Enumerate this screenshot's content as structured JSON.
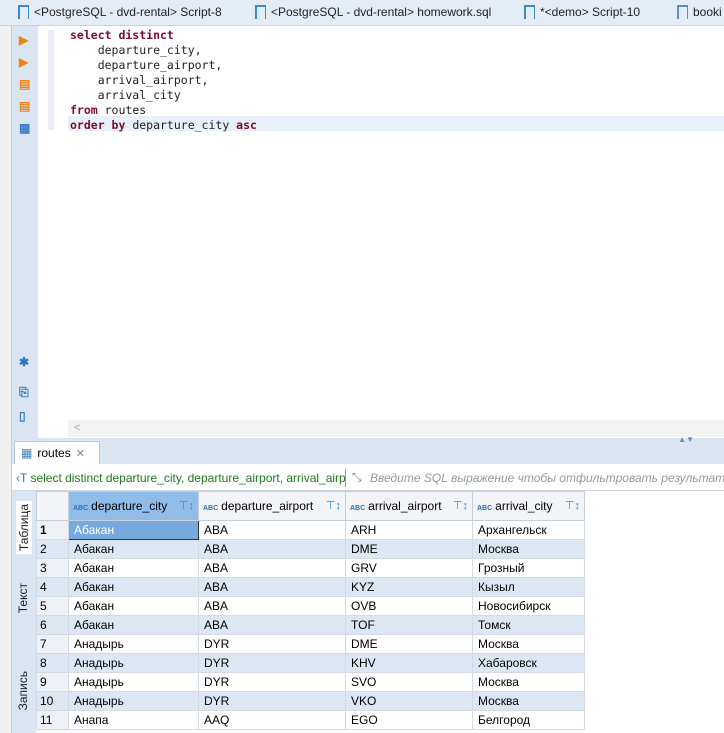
{
  "editor_tabs": [
    "<PostgreSQL - dvd-rental> Script-8",
    "<PostgreSQL - dvd-rental> homework.sql",
    "*<demo> Script-10",
    "booki"
  ],
  "sql_lines": [
    [
      [
        "kw",
        "select distinct"
      ]
    ],
    [
      [
        "",
        "    departure_city,"
      ]
    ],
    [
      [
        "",
        "    departure_airport,"
      ]
    ],
    [
      [
        "",
        "    arrival_airport,"
      ]
    ],
    [
      [
        "",
        "    arrival_city"
      ]
    ],
    [
      [
        "kw",
        "from"
      ],
      [
        "",
        " routes"
      ]
    ],
    [
      [
        "kw",
        "order by"
      ],
      [
        "",
        " departure_city "
      ],
      [
        "kw",
        "asc"
      ]
    ]
  ],
  "results": {
    "tab_label": "routes",
    "query_text": "select distinct departure_city, departure_airport, arrival_airport",
    "filter_placeholder": "Введите SQL выражение чтобы отфильтровать результаты",
    "side_tabs": [
      "Таблица",
      "Текст",
      "Запись"
    ],
    "columns": [
      "departure_city",
      "departure_airport",
      "arrival_airport",
      "arrival_city"
    ],
    "rows": [
      [
        "1",
        "Абакан",
        "ABA",
        "ARH",
        "Архангельск"
      ],
      [
        "2",
        "Абакан",
        "ABA",
        "DME",
        "Москва"
      ],
      [
        "3",
        "Абакан",
        "ABA",
        "GRV",
        "Грозный"
      ],
      [
        "4",
        "Абакан",
        "ABA",
        "KYZ",
        "Кызыл"
      ],
      [
        "5",
        "Абакан",
        "ABA",
        "OVB",
        "Новосибирск"
      ],
      [
        "6",
        "Абакан",
        "ABA",
        "TOF",
        "Томск"
      ],
      [
        "7",
        "Анадырь",
        "DYR",
        "DME",
        "Москва"
      ],
      [
        "8",
        "Анадырь",
        "DYR",
        "KHV",
        "Хабаровск"
      ],
      [
        "9",
        "Анадырь",
        "DYR",
        "SVO",
        "Москва"
      ],
      [
        "10",
        "Анадырь",
        "DYR",
        "VKO",
        "Москва"
      ],
      [
        "11",
        "Анапа",
        "AAQ",
        "EGO",
        "Белгород"
      ]
    ]
  }
}
